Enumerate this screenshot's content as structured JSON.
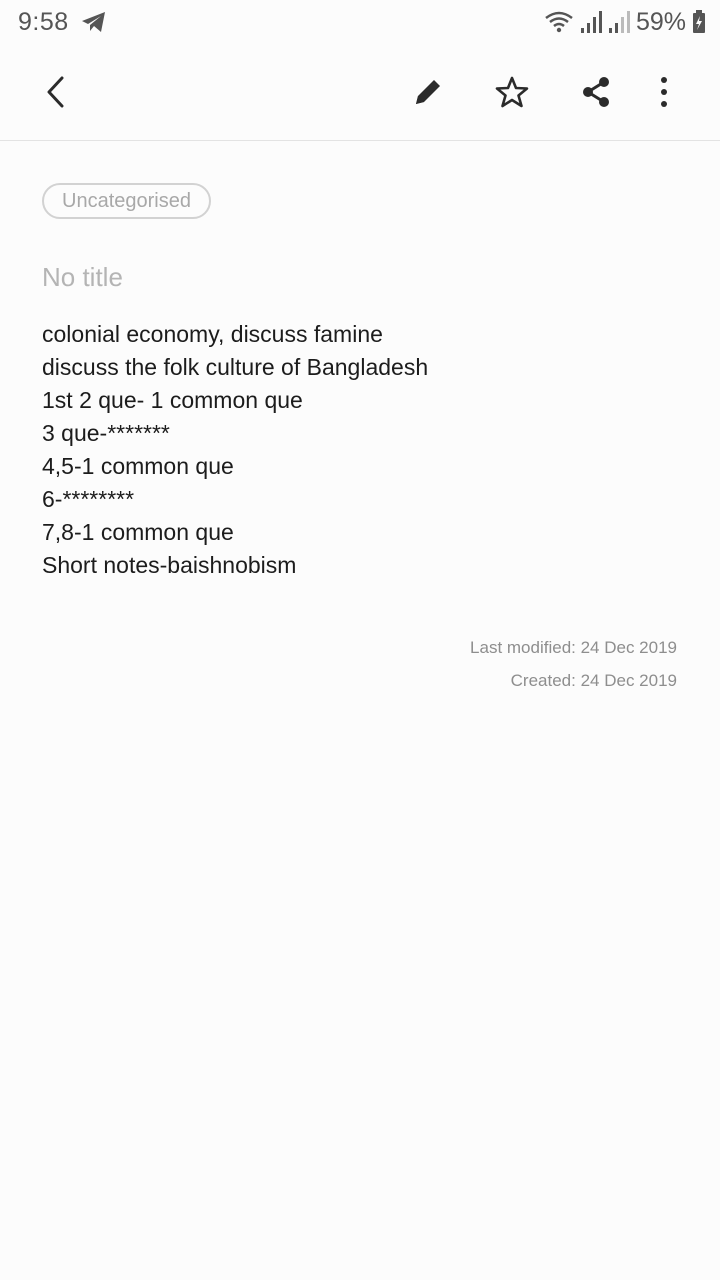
{
  "status_bar": {
    "time": "9:58",
    "battery": "59%",
    "icons": [
      "telegram-icon",
      "wifi-icon",
      "signal-icon",
      "signal-icon",
      "battery-charging-icon"
    ]
  },
  "toolbar": {
    "icons": [
      "back-arrow-icon",
      "pencil-icon",
      "star-outline-icon",
      "share-icon",
      "more-vertical-icon"
    ]
  },
  "note": {
    "category": "Uncategorised",
    "title": "No title",
    "lines": [
      "colonial economy, discuss famine",
      "discuss the folk culture of Bangladesh",
      "1st 2 que- 1 common que",
      "3 que-*******",
      "4,5-1 common que",
      "6-********",
      "7,8-1 common que",
      "Short notes-baishnobism"
    ],
    "last_modified": "Last modified: 24 Dec 2019",
    "created": "Created: 24 Dec 2019"
  },
  "colors": {
    "background": "#fcfcfc",
    "icon": "#2b2b2b",
    "muted_text": "#8e8e8e"
  }
}
